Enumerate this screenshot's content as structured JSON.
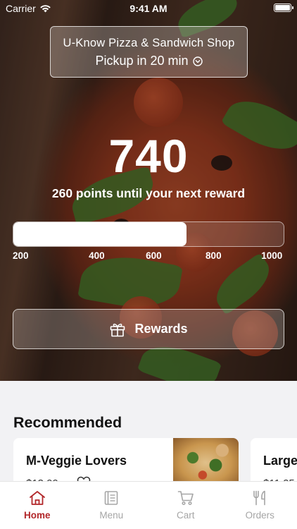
{
  "status_bar": {
    "carrier": "Carrier",
    "time": "9:41 AM"
  },
  "store": {
    "name": "U-Know Pizza & Sandwich Shop",
    "pickup": "Pickup in 20 min"
  },
  "rewards": {
    "points": "740",
    "until_text": "260 points until your next reward",
    "progress_fraction": 0.64,
    "ticks": [
      "200",
      "400",
      "600",
      "800",
      "1000"
    ],
    "button_label": "Rewards"
  },
  "recommended": {
    "title": "Recommended",
    "items": [
      {
        "name": "M-Veggie Lovers",
        "price": "$13.99"
      },
      {
        "name": "Large",
        "price": "$11.25"
      }
    ]
  },
  "tabs": [
    {
      "label": "Home",
      "icon": "home-icon",
      "active": true
    },
    {
      "label": "Menu",
      "icon": "menu-book-icon",
      "active": false
    },
    {
      "label": "Cart",
      "icon": "cart-icon",
      "active": false
    },
    {
      "label": "Orders",
      "icon": "fork-knife-icon",
      "active": false
    }
  ],
  "colors": {
    "accent": "#b2272a",
    "inactive": "#a5a5a5"
  }
}
